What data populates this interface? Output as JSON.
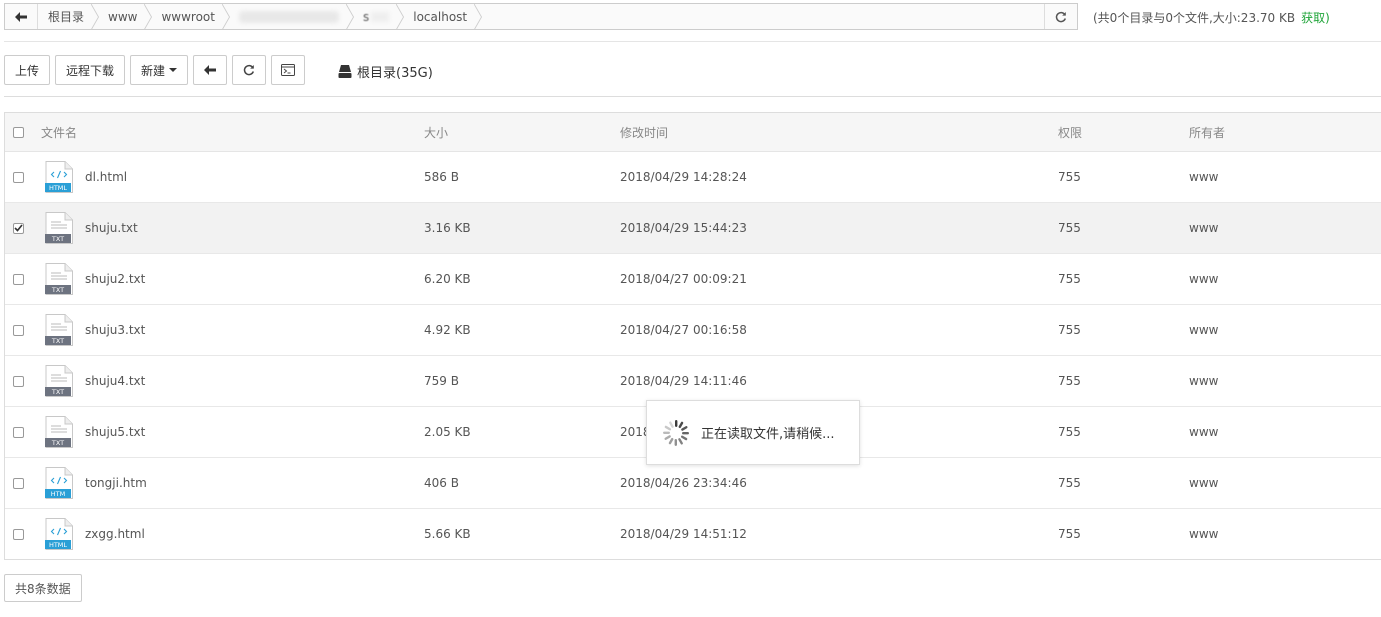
{
  "pathbar": {
    "crumbs": [
      "根目录",
      "www",
      "wwwroot",
      "",
      "s",
      "localhost"
    ],
    "info": "(共0个目录与0个文件,大小:23.70 KB",
    "fetch_label": "获取)"
  },
  "toolbar": {
    "upload_label": "上传",
    "remote_download_label": "远程下载",
    "new_label": "新建",
    "disk_label": "根目录(35G)"
  },
  "table": {
    "headers": {
      "name": "文件名",
      "size": "大小",
      "time": "修改时间",
      "perm": "权限",
      "owner": "所有者"
    },
    "rows": [
      {
        "type": "HTML",
        "name": "dl.html",
        "size": "586 B",
        "time": "2018/04/29 14:28:24",
        "perm": "755",
        "owner": "www",
        "checked": false
      },
      {
        "type": "TXT",
        "name": "shuju.txt",
        "size": "3.16 KB",
        "time": "2018/04/29 15:44:23",
        "perm": "755",
        "owner": "www",
        "checked": true
      },
      {
        "type": "TXT",
        "name": "shuju2.txt",
        "size": "6.20 KB",
        "time": "2018/04/27 00:09:21",
        "perm": "755",
        "owner": "www",
        "checked": false
      },
      {
        "type": "TXT",
        "name": "shuju3.txt",
        "size": "4.92 KB",
        "time": "2018/04/27 00:16:58",
        "perm": "755",
        "owner": "www",
        "checked": false
      },
      {
        "type": "TXT",
        "name": "shuju4.txt",
        "size": "759 B",
        "time": "2018/04/29 14:11:46",
        "perm": "755",
        "owner": "www",
        "checked": false
      },
      {
        "type": "TXT",
        "name": "shuju5.txt",
        "size": "2.05 KB",
        "time": "2018",
        "perm": "755",
        "owner": "www",
        "checked": false
      },
      {
        "type": "HTM",
        "name": "tongji.htm",
        "size": "406 B",
        "time": "2018/04/26 23:34:46",
        "perm": "755",
        "owner": "www",
        "checked": false
      },
      {
        "type": "HTML",
        "name": "zxgg.html",
        "size": "5.66 KB",
        "time": "2018/04/29 14:51:12",
        "perm": "755",
        "owner": "www",
        "checked": false
      }
    ]
  },
  "footer": {
    "count_label": "共8条数据"
  },
  "loading": {
    "text": "正在读取文件,请稍候..."
  },
  "colors": {
    "accent_green": "#20a53a",
    "html_badge": "#2a9fd6",
    "txt_badge": "#6d7380"
  },
  "icons": [
    "arrow-left-icon",
    "refresh-icon",
    "terminal-icon",
    "hdd-icon",
    "spinner-icon",
    "file-html-icon",
    "file-txt-icon"
  ]
}
